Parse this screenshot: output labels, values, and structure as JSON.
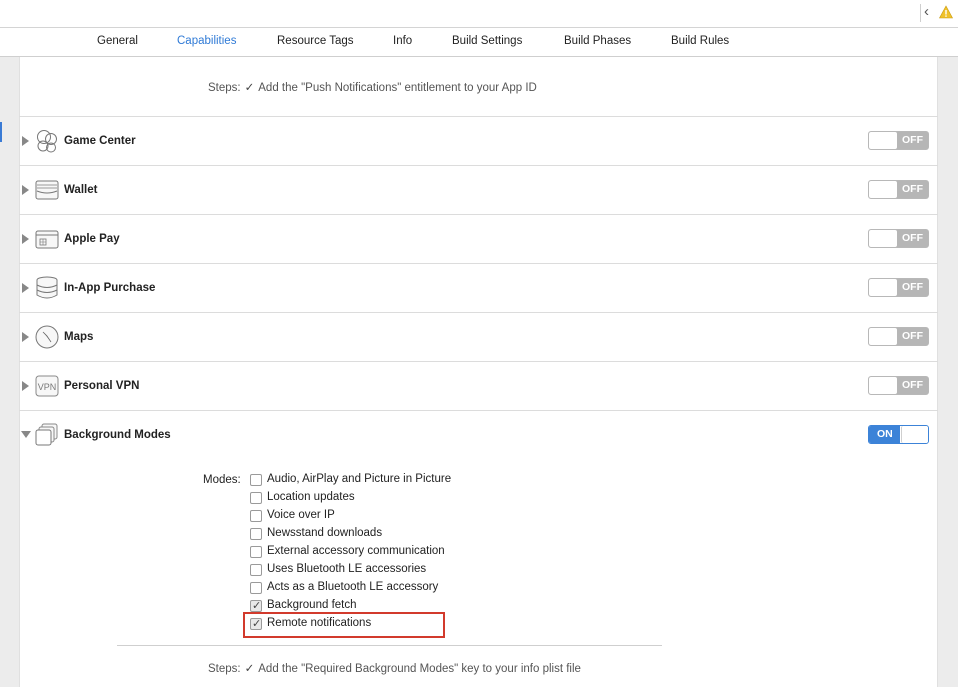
{
  "tabs": [
    {
      "label": "General",
      "active": false
    },
    {
      "label": "Capabilities",
      "active": true
    },
    {
      "label": "Resource Tags",
      "active": false
    },
    {
      "label": "Info",
      "active": false
    },
    {
      "label": "Build Settings",
      "active": false
    },
    {
      "label": "Build Phases",
      "active": false
    },
    {
      "label": "Build Rules",
      "active": false
    }
  ],
  "toolbar": {
    "back_icon": "chevron-left-icon",
    "warning_icon": "warning-triangle-icon",
    "warning_color": "#f0c22b"
  },
  "push_steps": {
    "label": "Steps:",
    "check": "✓",
    "text": "Add the \"Push Notifications\" entitlement to your App ID"
  },
  "capabilities": [
    {
      "title": "Game Center",
      "icon": "game-center-icon",
      "state": "OFF",
      "expanded": false
    },
    {
      "title": "Wallet",
      "icon": "wallet-icon",
      "state": "OFF",
      "expanded": false
    },
    {
      "title": "Apple Pay",
      "icon": "apple-pay-icon",
      "state": "OFF",
      "expanded": false
    },
    {
      "title": "In-App Purchase",
      "icon": "in-app-purchase-icon",
      "state": "OFF",
      "expanded": false
    },
    {
      "title": "Maps",
      "icon": "maps-icon",
      "state": "OFF",
      "expanded": false
    },
    {
      "title": "Personal VPN",
      "icon": "vpn-icon",
      "icon_text": "VPN",
      "state": "OFF",
      "expanded": false
    },
    {
      "title": "Background Modes",
      "icon": "background-modes-icon",
      "state": "ON",
      "expanded": true
    }
  ],
  "background_modes": {
    "label": "Modes:",
    "options": [
      {
        "label": "Audio, AirPlay and Picture in Picture",
        "checked": false
      },
      {
        "label": "Location updates",
        "checked": false
      },
      {
        "label": "Voice over IP",
        "checked": false
      },
      {
        "label": "Newsstand downloads",
        "checked": false
      },
      {
        "label": "External accessory communication",
        "checked": false
      },
      {
        "label": "Uses Bluetooth LE accessories",
        "checked": false
      },
      {
        "label": "Acts as a Bluetooth LE accessory",
        "checked": false
      },
      {
        "label": "Background fetch",
        "checked": true
      },
      {
        "label": "Remote notifications",
        "checked": true
      }
    ],
    "highlight_color": "#d23a2c"
  },
  "bg_steps": {
    "label": "Steps:",
    "check": "✓",
    "text": "Add the \"Required Background Modes\" key to your info plist file"
  },
  "colors": {
    "accent": "#2f7ad6",
    "toggle_on": "#3c83d8",
    "toggle_off": "#b6b6b6"
  }
}
